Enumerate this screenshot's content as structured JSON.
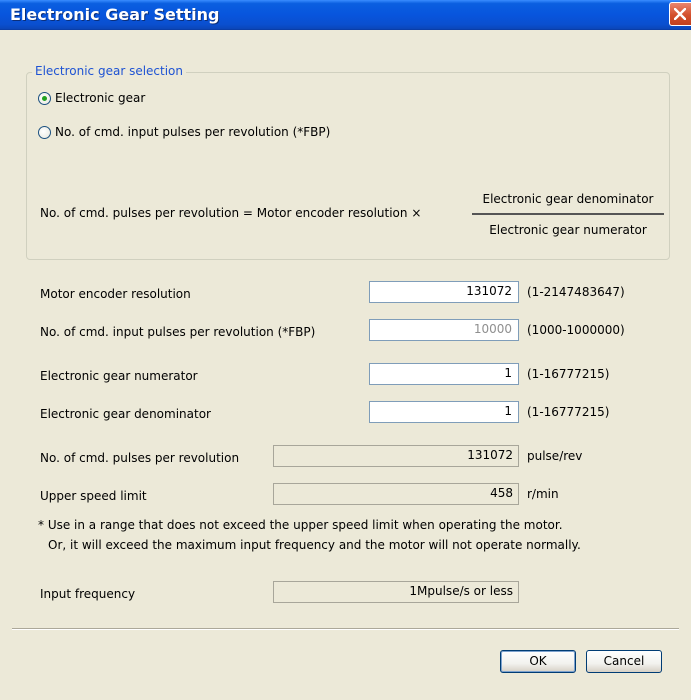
{
  "window": {
    "title": "Electronic Gear Setting"
  },
  "group": {
    "legend": "Electronic gear selection",
    "options": [
      {
        "label": "Electronic gear",
        "checked": true
      },
      {
        "label": "No. of cmd. input pulses per revolution (*FBP)",
        "checked": false
      }
    ],
    "formula": {
      "left": "No. of cmd. pulses per revolution = Motor encoder resolution ×",
      "numerator": "Electronic gear denominator",
      "denominator": "Electronic gear numerator"
    }
  },
  "fields": [
    {
      "label": "Motor encoder resolution",
      "value": "131072",
      "range": "(1-2147483647)"
    },
    {
      "label": "No. of cmd. input pulses per revolution (*FBP)",
      "value": "10000",
      "range": "(1000-1000000)"
    },
    {
      "label": "Electronic gear numerator",
      "value": "1",
      "range": "(1-16777215)"
    },
    {
      "label": "Electronic gear denominator",
      "value": "1",
      "range": "(1-16777215)"
    }
  ],
  "results": [
    {
      "label": "No. of cmd. pulses per revolution",
      "value": "131072",
      "unit": "pulse/rev"
    },
    {
      "label": "Upper speed limit",
      "value": "458",
      "unit": "r/min"
    }
  ],
  "note": {
    "line1": "* Use in a range that does not exceed the upper speed limit when operating the motor.",
    "line2": "Or, it will exceed the maximum input frequency and the motor will not operate normally."
  },
  "input_frequency": {
    "label": "Input frequency",
    "value": "1Mpulse/s or less"
  },
  "buttons": {
    "ok": "OK",
    "cancel": "Cancel"
  },
  "icons": {
    "close": "close-icon"
  },
  "colors": {
    "titlebar": "#0855dd",
    "legend": "#1e53d3",
    "radio_dot": "#21a121",
    "close_button": "#d3502d"
  }
}
